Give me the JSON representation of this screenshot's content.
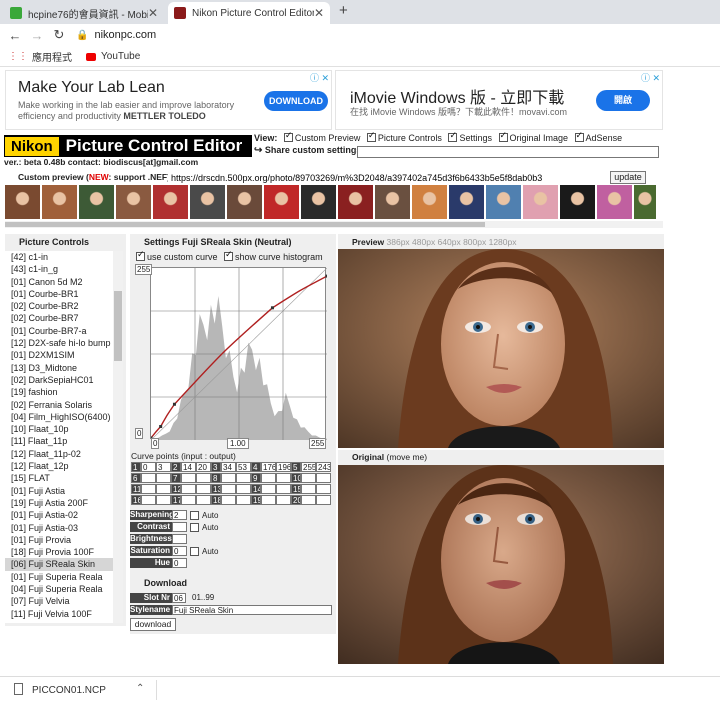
{
  "browser": {
    "tabs": [
      {
        "title": "hcpine76的會員資訊 - Mobile01",
        "active": false
      },
      {
        "title": "Nikon Picture Control Editor",
        "active": true
      }
    ],
    "new_tab": "+",
    "url": "nikonpc.com",
    "bookmarks": [
      {
        "label": "應用程式"
      },
      {
        "label": "YouTube"
      }
    ]
  },
  "ads": [
    {
      "title": "Make Your Lab Lean",
      "text": "Make working in the lab easier and improve laboratory efficiency and productivity",
      "brand": "METTLER TOLEDO",
      "button": "DOWNLOAD"
    },
    {
      "title": "iMovie Windows 版 - 立即下載",
      "text": "在找 iMovie Windows 版嗎？下載此軟件！movavi.com",
      "button": "開啟"
    }
  ],
  "header": {
    "logo_nikon": "Nikon",
    "logo_title": "Picture Control Editor",
    "version": "ver.: beta 0.48b contact: biodiscus[at]gmail.com",
    "view_label": "View:",
    "view_options": [
      {
        "label": "Custom Preview",
        "checked": true
      },
      {
        "label": "Picture Controls",
        "checked": true
      },
      {
        "label": "Settings",
        "checked": true
      },
      {
        "label": "Original Image",
        "checked": true
      },
      {
        "label": "AdSense",
        "checked": true
      }
    ],
    "share_label": "Share custom settings",
    "share_value": ""
  },
  "custom_preview": {
    "label_start": "Custom preview (",
    "label_new": "NEW",
    "label_end": ": support .NEF)",
    "url": "https://drscdn.500px.org/photo/89703269/m%3D2048/a397402a745d3f6b6433b5e5f8dab0b3",
    "update_button": "update"
  },
  "thumbnails": [
    "#7a4a30",
    "#a0603a",
    "#3d5a36",
    "#8a5a40",
    "#b03030",
    "#4a4a4a",
    "#6a4a3a",
    "#c02828",
    "#2a2a2a",
    "#8a2020",
    "#6a5040",
    "#d08040",
    "#2a3a6a",
    "#5080b0",
    "#e0a0b0",
    "#1a1a1a",
    "#c060a0",
    "#4a6a30"
  ],
  "picture_controls": {
    "title": "Picture Controls",
    "items": [
      "[42] c1-in",
      "[43] c1-in_g",
      "[01] Canon 5d M2",
      "[01] Courbe-BR1",
      "[02] Courbe-BR2",
      "[02] Courbe-BR7",
      "[01] Courbe-BR7-a",
      "[12] D2X-safe hi-lo bump",
      "[01] D2XM1SIM",
      "[13] D3_Midtone",
      "[02] DarkSepiaHC01",
      "[19] fashion",
      "[02] Ferrania Solaris",
      "[04] Film_HighISO(6400)",
      "[10] Flaat_10p",
      "[11] Flaat_11p",
      "[12] Flaat_11p-02",
      "[12] Flaat_12p",
      "[15] FLAT",
      "[01] Fuji Astia",
      "[19] Fuji Astia 200F",
      "[01] Fuji Astia-02",
      "[01] Fuji Astia-03",
      "[01] Fuji Provia",
      "[18] Fuji Provia 100F",
      "[06] Fuji SReala Skin",
      "[01] Fuji Superia Reala",
      "[04] Fuji Superia Reala",
      "[07] Fuji Velvia",
      "[11] Fuji Velvia 100F"
    ],
    "selected_index": 25
  },
  "settings": {
    "title": "Settings Fuji SReala Skin (Neutral)",
    "use_custom_curve": {
      "label": "use custom curve",
      "checked": true
    },
    "show_histogram": {
      "label": "show curve histogram",
      "checked": true
    },
    "axis_top": "255",
    "axis_zero_left": "0",
    "axis_zero_bottom": "0",
    "gamma": "1.00",
    "axis_right": "255",
    "curve_points_label": "Curve points (input : output)",
    "curve_points": [
      [
        "1",
        "0",
        "3"
      ],
      [
        "2",
        "14",
        "20"
      ],
      [
        "3",
        "34",
        "53"
      ],
      [
        "4",
        "176",
        "196"
      ],
      [
        "5",
        "255",
        "243"
      ],
      [
        "6",
        "",
        ""
      ],
      [
        "7",
        "",
        ""
      ],
      [
        "8",
        "",
        ""
      ],
      [
        "9",
        "",
        ""
      ],
      [
        "10",
        "",
        ""
      ],
      [
        "11",
        "",
        ""
      ],
      [
        "12",
        "",
        ""
      ],
      [
        "13",
        "",
        ""
      ],
      [
        "14",
        "",
        ""
      ],
      [
        "15",
        "",
        ""
      ],
      [
        "16",
        "",
        ""
      ],
      [
        "17",
        "",
        ""
      ],
      [
        "18",
        "",
        ""
      ],
      [
        "19",
        "",
        ""
      ],
      [
        "20",
        "",
        ""
      ]
    ],
    "adjustments": [
      {
        "label": "Sharpening",
        "value": "2",
        "auto": true,
        "auto_label": "Auto"
      },
      {
        "label": "Contrast",
        "value": "",
        "auto": true,
        "auto_label": "Auto"
      },
      {
        "label": "Brightness",
        "value": "",
        "auto": false
      },
      {
        "label": "Saturation",
        "value": "0",
        "auto": true,
        "auto_label": "Auto"
      },
      {
        "label": "Hue",
        "value": "0",
        "auto": false
      }
    ],
    "download_title": "Download",
    "slot_label": "Slot Nr",
    "slot_value": "06",
    "slot_range": "01..99",
    "stylename_label": "Stylename",
    "stylename_value": "Fuji SReala Skin",
    "download_button": "download"
  },
  "preview": {
    "label": "Preview",
    "sizes": "386px 480px 640px 800px 1280px",
    "original_label": "Original",
    "original_hint": "(move me)"
  },
  "downloads_bar": {
    "filename": "PICCON01.NCP"
  },
  "colors": {
    "accent": "#1a73e8",
    "nikon_yellow": "#ffd400",
    "new_red": "#e00000"
  }
}
